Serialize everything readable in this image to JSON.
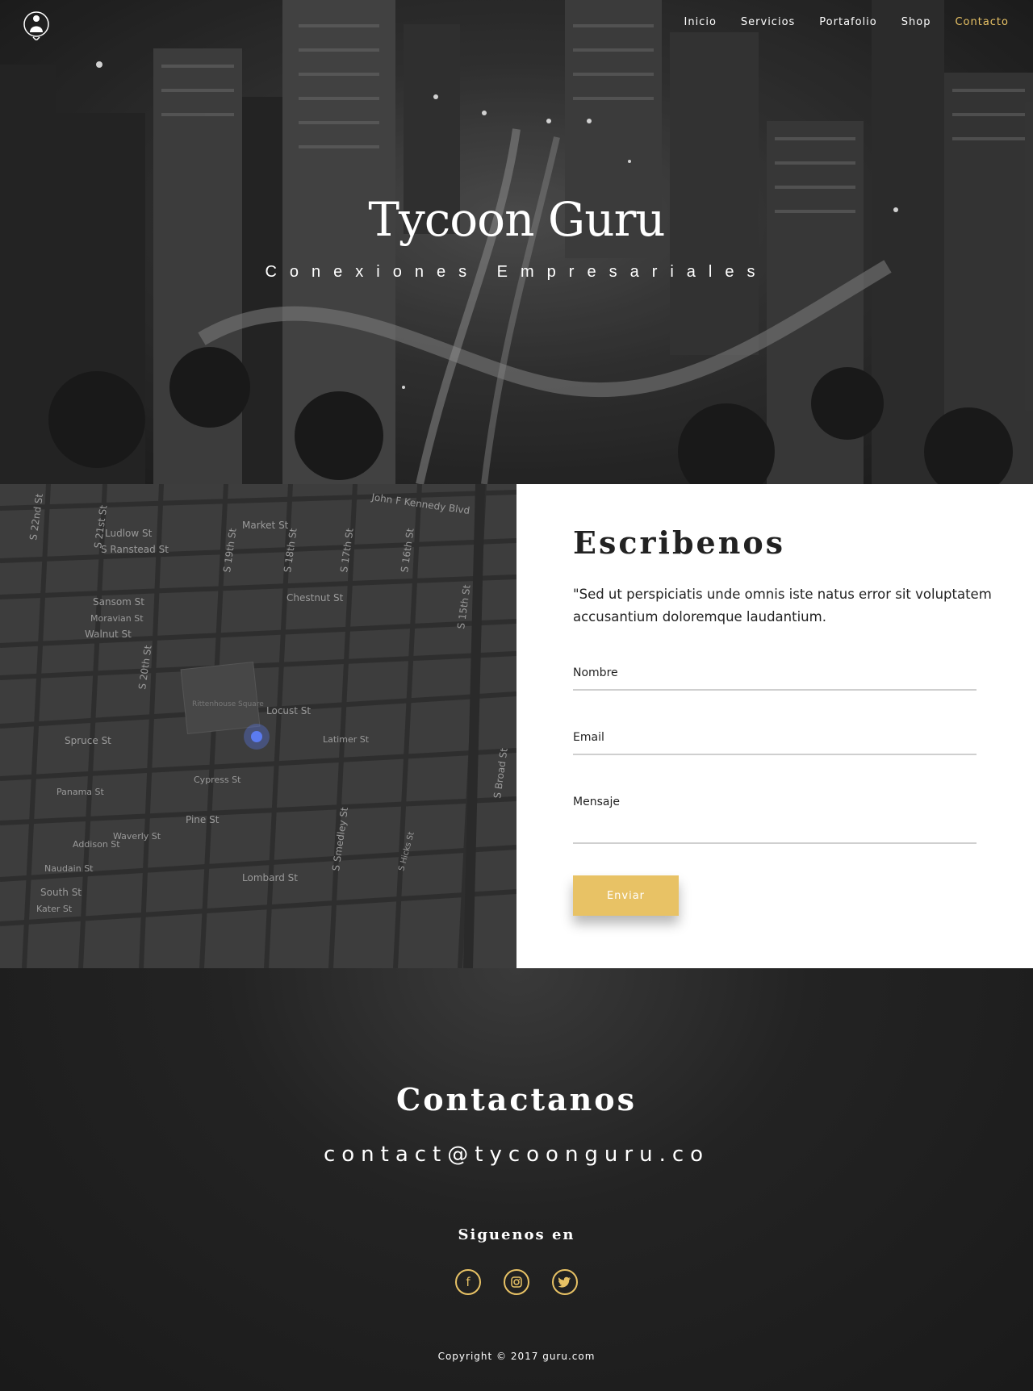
{
  "nav": {
    "items": [
      "Inicio",
      "Servicios",
      "Portafolio",
      "Shop",
      "Contacto"
    ],
    "active": "Contacto"
  },
  "hero": {
    "title": "Tycoon Guru",
    "subtitle": "Conexiones Empresariales"
  },
  "map": {
    "streets": [
      "Market St",
      "John F Kennedy Blvd",
      "Ludlow St",
      "S Ranstead St",
      "Chestnut St",
      "Sansom St",
      "Moravian St",
      "Walnut St",
      "Locust St",
      "Latimer St",
      "Spruce St",
      "Cypress St",
      "Panama St",
      "Pine St",
      "Waverly St",
      "Addison St",
      "Lombard St",
      "Naudain St",
      "South St",
      "Kater St",
      "S 22nd St",
      "S 21st St",
      "S 20th St",
      "S 19th St",
      "S 18th St",
      "S 17th St",
      "S 16th St",
      "S 15th St",
      "S Broad St",
      "S Smedley St",
      "S Hicks St"
    ],
    "place": "Rittenhouse Square"
  },
  "form": {
    "title": "Escribenos",
    "description": "\"Sed ut perspiciatis unde omnis iste natus error sit voluptatem accusantium doloremque laudantium.",
    "name_label": "Nombre",
    "email_label": "Email",
    "message_label": "Mensaje",
    "submit_label": "Enviar"
  },
  "footer": {
    "title": "Contactanos",
    "email": "contact@tycoonguru.co",
    "follow": "Siguenos en",
    "social": [
      "facebook-icon",
      "instagram-icon",
      "twitter-icon"
    ],
    "copyright": "Copyright © 2017 guru.com"
  },
  "colors": {
    "accent": "#e8c265",
    "dark": "#1c1c1c",
    "map_bg": "#3d3d3d",
    "marker": "#5b7bf0"
  }
}
